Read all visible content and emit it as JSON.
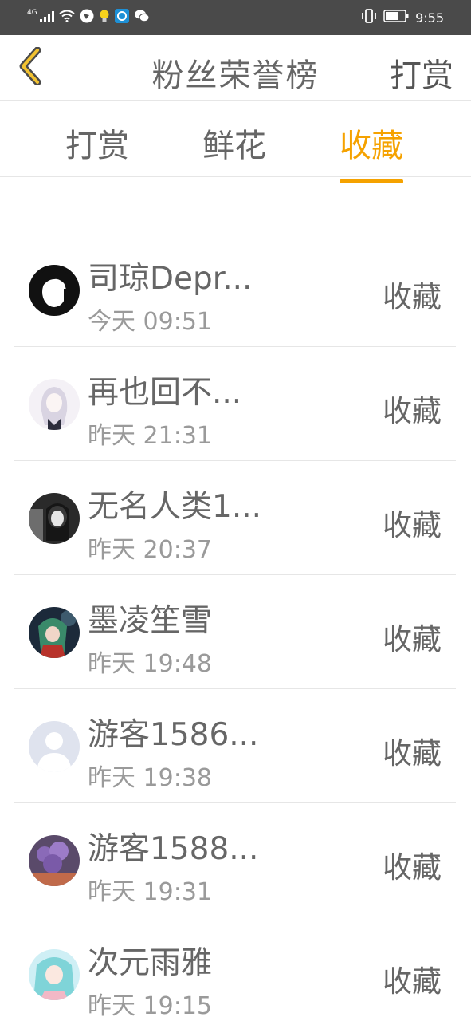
{
  "status_bar": {
    "network": "4G",
    "time": "9:55",
    "icons": [
      "signal-icon",
      "wifi-icon",
      "app-icon-1",
      "bulb-icon",
      "app-icon-2",
      "wechat-icon",
      "vibrate-icon",
      "battery-icon"
    ]
  },
  "header": {
    "title": "粉丝荣誉榜",
    "right_action": "打赏",
    "back_icon": "chevron-left-icon"
  },
  "tabs": [
    {
      "label": "打赏",
      "active": false
    },
    {
      "label": "鲜花",
      "active": false
    },
    {
      "label": "收藏",
      "active": true
    }
  ],
  "colors": {
    "accent": "#f5a200",
    "status_bar": "#4a4a4a",
    "text": "#666666",
    "subtext": "#9a9a9a",
    "divider": "#e6e6e6"
  },
  "fans": [
    {
      "name": "司琼Depr...",
      "time": "今天 09:51",
      "action": "收藏"
    },
    {
      "name": "再也回不...",
      "time": "昨天 21:31",
      "action": "收藏"
    },
    {
      "name": "无名人类1...",
      "time": "昨天 20:37",
      "action": "收藏"
    },
    {
      "name": "墨凌笙雪",
      "time": "昨天 19:48",
      "action": "收藏"
    },
    {
      "name": "游客1586...",
      "time": "昨天 19:38",
      "action": "收藏"
    },
    {
      "name": "游客1588...",
      "time": "昨天 19:31",
      "action": "收藏"
    },
    {
      "name": "次元雨雅",
      "time": "昨天 19:15",
      "action": "收藏"
    }
  ]
}
